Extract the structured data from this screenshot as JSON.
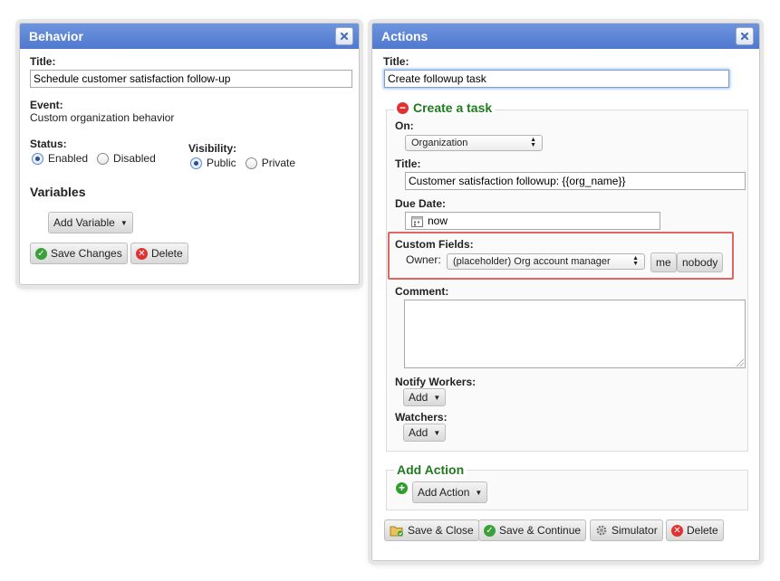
{
  "behavior": {
    "header": "Behavior",
    "title_label": "Title:",
    "title_value": "Schedule customer satisfaction follow-up",
    "event_label": "Event:",
    "event_value": "Custom organization behavior",
    "status_label": "Status:",
    "status_enabled": "Enabled",
    "status_disabled": "Disabled",
    "visibility_label": "Visibility:",
    "visibility_public": "Public",
    "visibility_private": "Private",
    "variables_heading": "Variables",
    "add_variable": "Add Variable",
    "save_changes": "Save Changes",
    "delete": "Delete"
  },
  "actions": {
    "header": "Actions",
    "title_label": "Title:",
    "title_value": "Create followup task",
    "create_task": {
      "legend": "Create a task",
      "on_label": "On:",
      "on_value": "Organization",
      "title_label": "Title:",
      "title_value": "Customer satisfaction followup: {{org_name}}",
      "due_label": "Due Date:",
      "due_value": "now",
      "custom_fields_label": "Custom Fields:",
      "owner_label": "Owner:",
      "owner_value": "(placeholder) Org account manager",
      "me_button": "me",
      "nobody_button": "nobody",
      "comment_label": "Comment:",
      "notify_label": "Notify Workers:",
      "notify_add": "Add",
      "watchers_label": "Watchers:",
      "watchers_add": "Add"
    },
    "add_action_legend": "Add Action",
    "add_action_button": "Add Action",
    "save_close": "Save & Close",
    "save_continue": "Save & Continue",
    "simulator": "Simulator",
    "delete": "Delete"
  },
  "colors": {
    "header_blue": "#5580d3",
    "legend_green": "#1f7a1f",
    "highlight_red": "#e06666"
  }
}
